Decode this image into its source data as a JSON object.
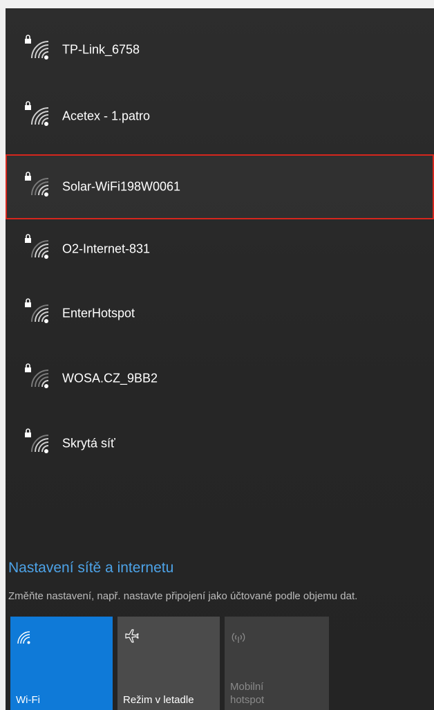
{
  "networks": [
    {
      "name": "TP-Link_6758",
      "icon": "secured-wifi-icon"
    },
    {
      "name": "Acetex - 1.patro",
      "icon": "secured-wifi-icon"
    },
    {
      "name": "Solar-WiFi198W0061",
      "icon": "secured-wifi-icon",
      "selected": true
    },
    {
      "name": "O2-Internet-831",
      "icon": "secured-wifi-icon"
    },
    {
      "name": "EnterHotspot",
      "icon": "secured-wifi-icon"
    },
    {
      "name": "WOSA.CZ_9BB2",
      "icon": "secured-wifi-icon"
    },
    {
      "name": "Skrytá síť",
      "icon": "secured-wifi-icon"
    }
  ],
  "settings": {
    "link": "Nastavení sítě a internetu",
    "description": "Změňte nastavení, např. nastavte připojení jako účtované podle objemu dat."
  },
  "quick_actions": {
    "wifi": {
      "label": "Wi-Fi",
      "icon": "wifi-icon",
      "active": true
    },
    "airplane": {
      "label": "Režim v letadle",
      "icon": "airplane-icon",
      "active": false
    },
    "hotspot": {
      "label": "Mobilní\nhotspot",
      "label_line1": "Mobilní",
      "label_line2": "hotspot",
      "icon": "hotspot-icon",
      "disabled": true
    }
  },
  "colors": {
    "panel_background": "#2b2b2b",
    "accent": "#0f7ad8",
    "link": "#4da3e8",
    "selection_border": "#d7261d"
  }
}
